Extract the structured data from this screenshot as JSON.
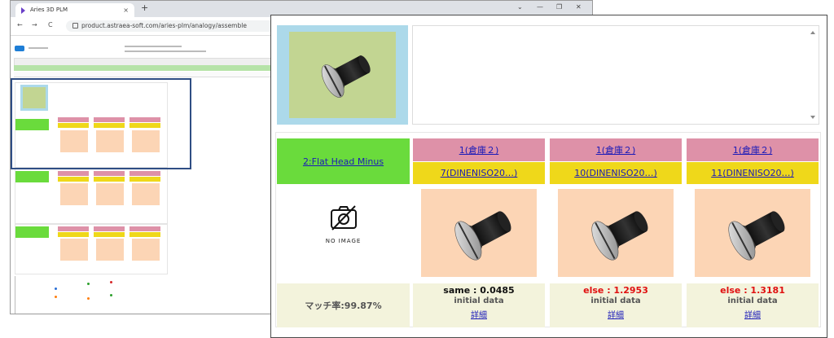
{
  "browser": {
    "tab_title": "Aries 3D PLM",
    "tab_close": "×",
    "new_tab": "+",
    "minimize": "—",
    "restore": "❐",
    "close": "✕",
    "back": "←",
    "forward": "→",
    "reload": "C",
    "url": "product.astraea-soft.com/aries-plm/analogy/assemble"
  },
  "zoom_panel": {
    "query": {
      "name": "2:Flat Head Minus",
      "no_image": "NO IMAGE",
      "match_rate": "マッチ率:99.87%"
    },
    "results": [
      {
        "location": "1(倉庫２)",
        "part": "7(DINENISO20…)",
        "score": "same : 0.0485",
        "score_type": "same",
        "status": "initial data",
        "detail": "詳細"
      },
      {
        "location": "1(倉庫２)",
        "part": "10(DINENISO20…)",
        "score": "else : 1.2953",
        "score_type": "else",
        "status": "initial data",
        "detail": "詳細"
      },
      {
        "location": "1(倉庫２)",
        "part": "11(DINENISO20…)",
        "score": "else : 1.3181",
        "score_type": "else",
        "status": "initial data",
        "detail": "詳細"
      }
    ]
  },
  "colors": {
    "highlight_frame": "#2f4e84",
    "query_green": "#6adb3c",
    "location_pink": "#de91a8",
    "part_yellow": "#efd81a",
    "thumb_peach": "#fcd5b5",
    "else_red": "#e01010"
  }
}
